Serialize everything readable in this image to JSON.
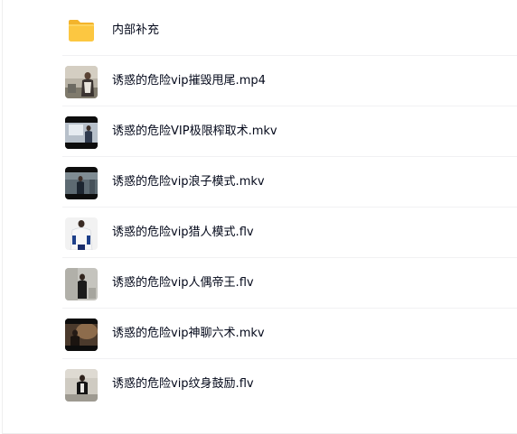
{
  "files": [
    {
      "name": "内部补充",
      "icon": "folder-icon",
      "type": "folder"
    },
    {
      "name": "诱惑的危险vip摧毁甩尾.mp4",
      "icon": "video-thumbnail",
      "type": "video"
    },
    {
      "name": "诱惑的危险VIP极限榨取术.mkv",
      "icon": "video-thumbnail",
      "type": "video"
    },
    {
      "name": "诱惑的危险vip浪子模式.mkv",
      "icon": "video-thumbnail",
      "type": "video"
    },
    {
      "name": "诱惑的危险vip猎人模式.flv",
      "icon": "video-thumbnail",
      "type": "video"
    },
    {
      "name": "诱惑的危险vip人偶帝王.flv",
      "icon": "video-thumbnail",
      "type": "video"
    },
    {
      "name": "诱惑的危险vip神聊六术.mkv",
      "icon": "video-thumbnail",
      "type": "video"
    },
    {
      "name": "诱惑的危险vip纹身鼓励.flv",
      "icon": "video-thumbnail",
      "type": "video"
    }
  ],
  "colors": {
    "folder": "#fcc741",
    "text": "#03081a",
    "divider": "#f1f1f3"
  }
}
